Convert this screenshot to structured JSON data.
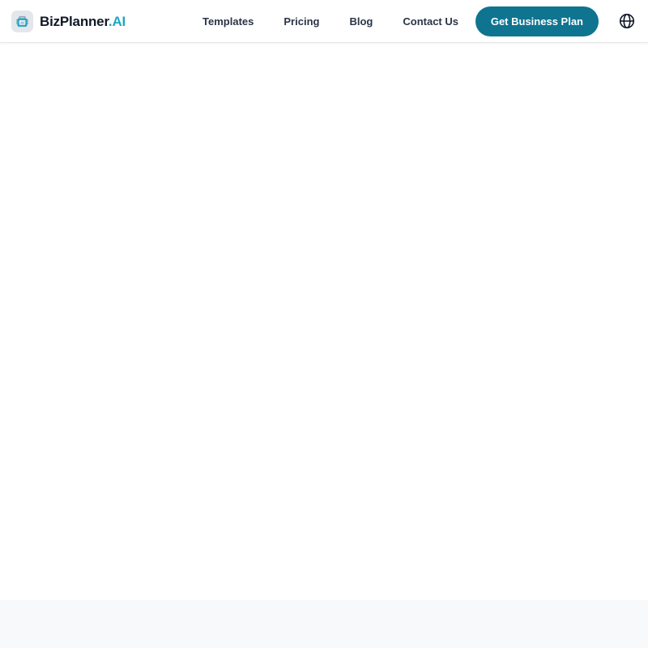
{
  "header": {
    "brand": {
      "logo_icon": "ai-briefcase-chip-icon",
      "logo_badge_text": "AI",
      "name_primary": "BizPlanner",
      "name_accent": ".AI"
    },
    "nav": [
      {
        "label": "Templates",
        "name": "nav-link-templates"
      },
      {
        "label": "Pricing",
        "name": "nav-link-pricing"
      },
      {
        "label": "Blog",
        "name": "nav-link-blog"
      },
      {
        "label": "Contact Us",
        "name": "nav-link-contact-us"
      }
    ],
    "cta": {
      "label": "Get Business Plan"
    },
    "language": {
      "icon": "globe-icon",
      "label": ""
    }
  },
  "main": {
    "content": ""
  },
  "bottom_band": {
    "content": ""
  },
  "colors": {
    "accent_teal": "#0e7490",
    "brand_accent": "#1ba7c4",
    "text_dark": "#111827",
    "nav_text": "#2b3444",
    "page_bg": "#ffffff",
    "band_bg": "#f8f9fb",
    "logo_bg": "#e3e7ec"
  }
}
